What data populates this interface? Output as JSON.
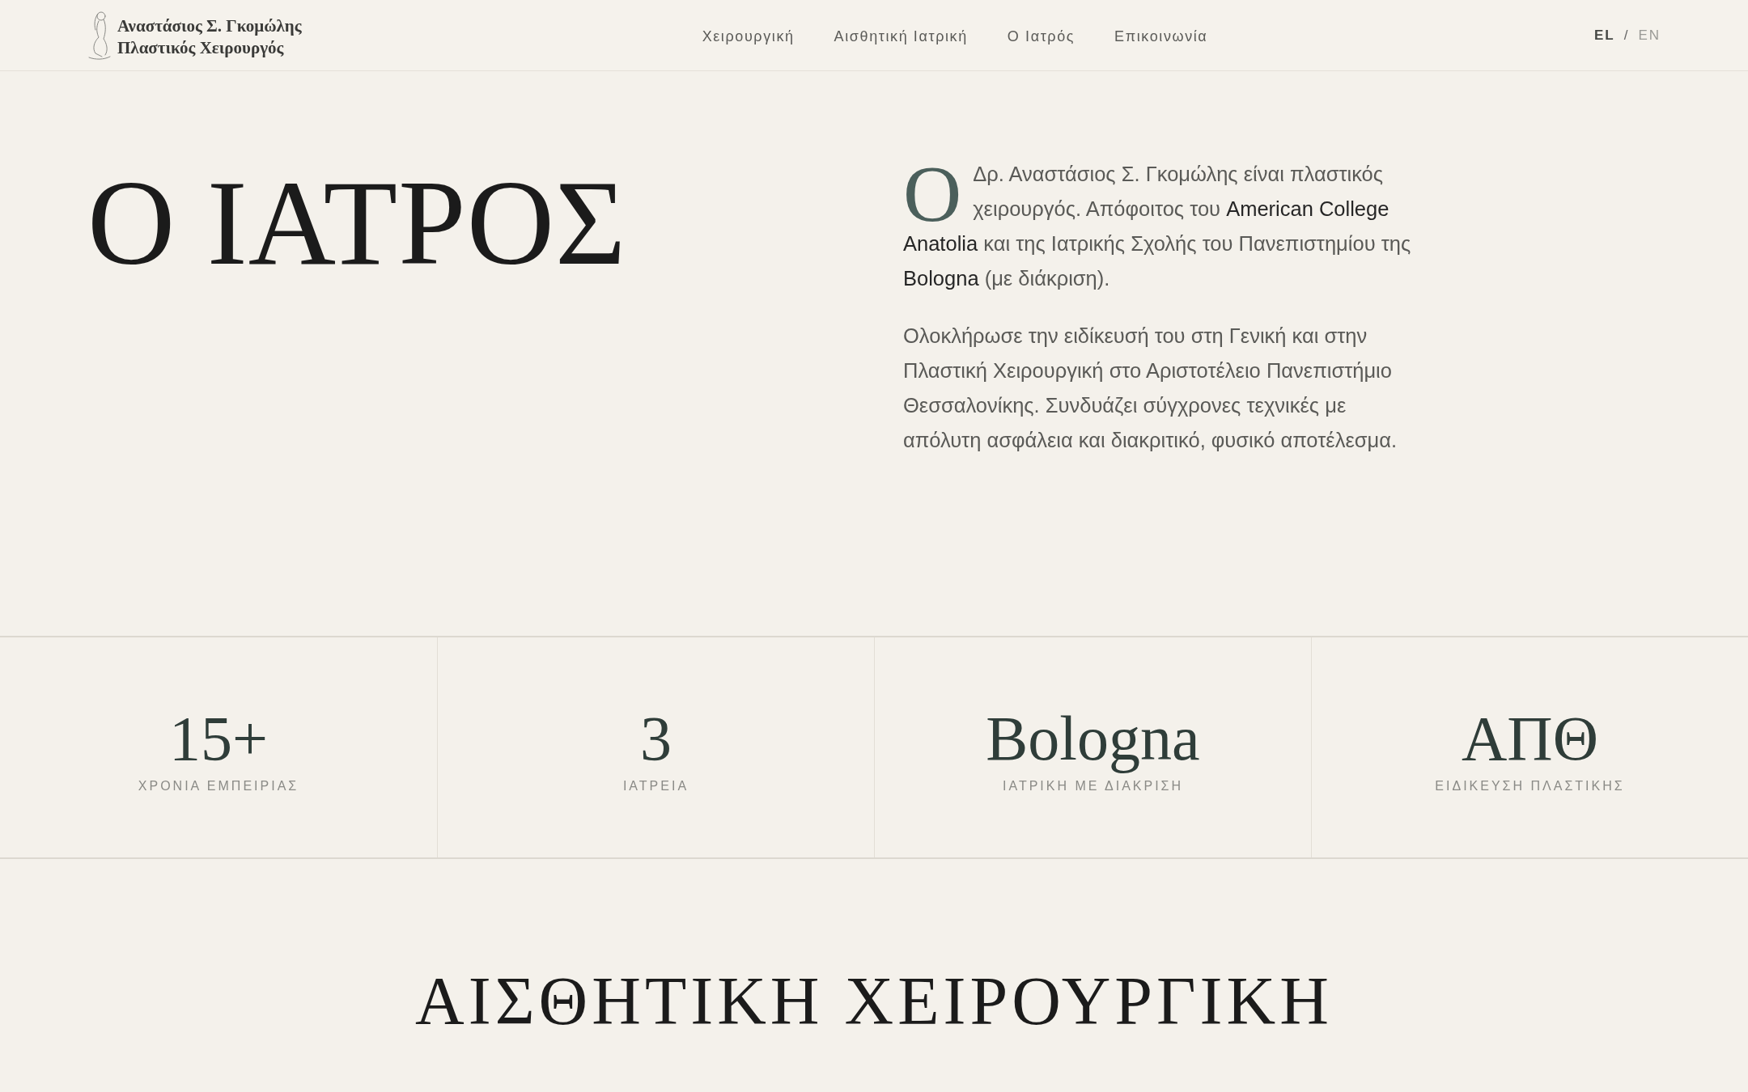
{
  "header": {
    "logo": {
      "name": "Αναστάσιος Σ. Γκομώλης",
      "subtitle": "Πλαστικός Χειρουργός"
    },
    "nav": [
      {
        "label": "Χειρουργική"
      },
      {
        "label": "Αισθητική Ιατρική"
      },
      {
        "label": "Ο Ιατρός"
      },
      {
        "label": "Επικοινωνία"
      }
    ],
    "languages": [
      {
        "label": "EL",
        "selected": true
      },
      {
        "label": "EN",
        "selected": false
      }
    ],
    "language_separator": "/"
  },
  "hero": {
    "title": "Ο ΙΑΤΡΟΣ",
    "paragraphs": [
      {
        "drop_cap": true,
        "text": "Ο Δρ. Αναστάσιος Σ. Γκομώλης είναι πλαστικός χειρουργός. Απόφοιτος του **American College Anatolia** και της Ιατρικής Σχολής του Πανεπιστημίου της **Bologna** (με διάκριση)."
      },
      {
        "drop_cap": false,
        "text": "Ολοκλήρωσε την ειδίκευσή του στη Γενική και στην Πλαστική Χειρουργική στο Αριστοτέλειο Πανεπιστήμιο Θεσσαλονίκης. Συνδυάζει σύγχρονες τεχνικές με απόλυτη ασφάλεια και διακριτικό, φυσικό αποτέλεσμα."
      }
    ]
  },
  "stats": [
    {
      "value": "15+",
      "label": "ΧΡΟΝΙΑ ΕΜΠΕΙΡΙΑΣ"
    },
    {
      "value": "3",
      "label": "ΙΑΤΡΕΙΑ"
    },
    {
      "value": "Bologna",
      "label": "ΙΑΤΡΙΚΗ ΜΕ ΔΙΑΚΡΙΣΗ"
    },
    {
      "value": "ΑΠΘ",
      "label": "ΕΙΔΙΚΕΥΣΗ ΠΛΑΣΤΙΚΗΣ"
    }
  ],
  "section": {
    "title": "ΑΙΣΘΗΤΙΚΗ ΧΕΙΡΟΥΡΓΙΚΗ"
  }
}
